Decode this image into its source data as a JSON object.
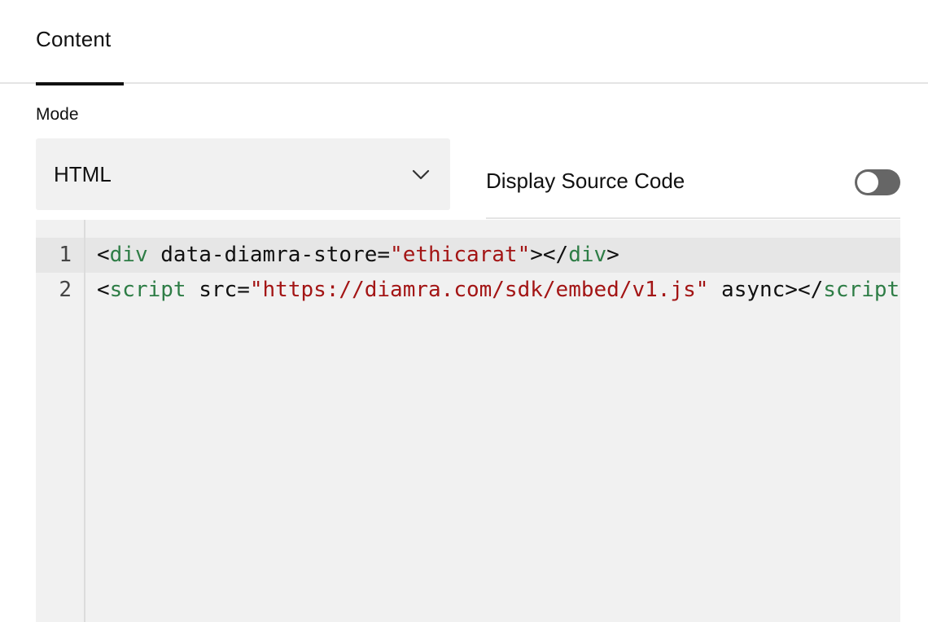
{
  "tabs": [
    {
      "label": "Content",
      "active": true
    }
  ],
  "mode": {
    "label": "Mode",
    "selected": "HTML"
  },
  "display_source_code": {
    "label": "Display Source Code",
    "enabled": false
  },
  "editor": {
    "line_numbers": [
      "1",
      "2"
    ],
    "line1": {
      "t1": "<",
      "t2": "div",
      "t3": " data-diamra-store=",
      "t4": "\"ethicarat\"",
      "t5": "></",
      "t6": "div",
      "t7": ">"
    },
    "line2": {
      "t1": "<",
      "t2": "script",
      "t3": " src=",
      "t4": "\"https://diamra.com/sdk/embed/v1.js\"",
      "t5": " async></",
      "t6": "script",
      "t7": ">"
    }
  },
  "colors": {
    "tag": "#2e7d46",
    "string": "#a31515",
    "toggle_off": "#666666",
    "field_bg": "#f1f1f1"
  },
  "icons": {
    "select_caret": "chevron-down-icon"
  }
}
